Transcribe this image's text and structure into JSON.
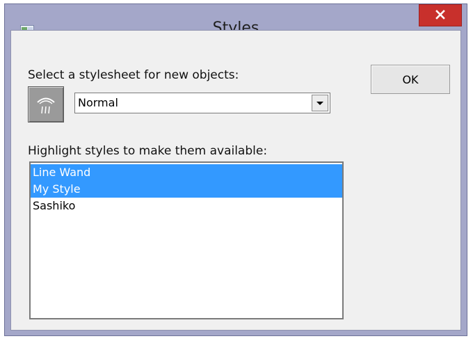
{
  "window": {
    "title": "Styles",
    "app_icon": "app-window-icon",
    "close_icon": "close-icon"
  },
  "stylesheet": {
    "label": "Select a stylesheet for new objects:",
    "button_icon": "stylesheet-icon",
    "selected_value": "Normal",
    "dropdown_icon": "dropdown-arrow-icon"
  },
  "ok_button": {
    "label": "OK"
  },
  "styles_list": {
    "label": "Highlight styles to make them available:",
    "items": [
      {
        "label": "Line Wand",
        "selected": true
      },
      {
        "label": "My Style",
        "selected": true
      },
      {
        "label": "Sashiko",
        "selected": false
      }
    ]
  },
  "colors": {
    "title_bar": "#a4a7c9",
    "close_button": "#c8302c",
    "selection": "#3399ff",
    "dialog_background": "#f0f0f0"
  }
}
